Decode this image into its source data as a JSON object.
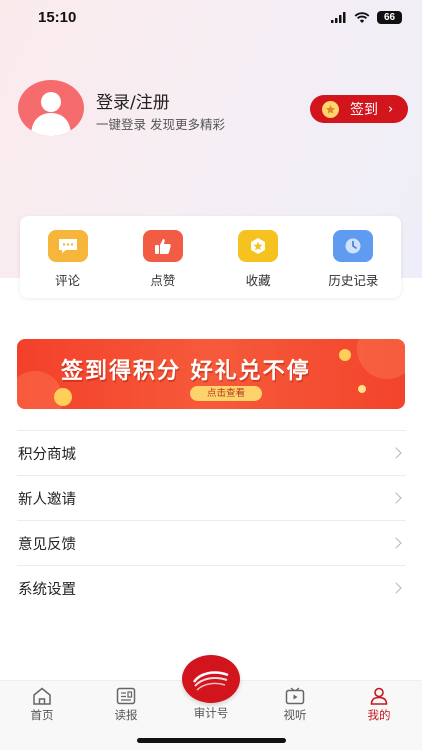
{
  "status_bar": {
    "time": "15:10",
    "battery": "66"
  },
  "profile": {
    "title": "登录/注册",
    "subtitle": "一键登录 发现更多精彩",
    "checkin_label": "签到",
    "checkin_arrow": "›"
  },
  "quick_actions": [
    {
      "label": "评论",
      "icon": "comment-icon",
      "color": "#f6b63c"
    },
    {
      "label": "点赞",
      "icon": "thumbs-up-icon",
      "color": "#f25c45"
    },
    {
      "label": "收藏",
      "icon": "star-icon",
      "color": "#f6c21f"
    },
    {
      "label": "历史记录",
      "icon": "clock-icon",
      "color": "#5f9bf0"
    }
  ],
  "banner": {
    "headline": "签到得积分  好礼兑不停",
    "button": "点击查看"
  },
  "menu": [
    {
      "label": "积分商城"
    },
    {
      "label": "新人邀请"
    },
    {
      "label": "意见反馈"
    },
    {
      "label": "系统设置"
    }
  ],
  "tabbar": {
    "tabs": [
      {
        "label": "首页",
        "icon": "home-icon"
      },
      {
        "label": "读报",
        "icon": "newspaper-icon"
      },
      {
        "label": "审计号",
        "icon": "audit-logo-icon"
      },
      {
        "label": "视听",
        "icon": "tv-icon"
      },
      {
        "label": "我的",
        "icon": "profile-icon"
      }
    ],
    "active_index": 4,
    "active_color": "#c8161e"
  },
  "colors": {
    "accent": "#d2141d"
  }
}
